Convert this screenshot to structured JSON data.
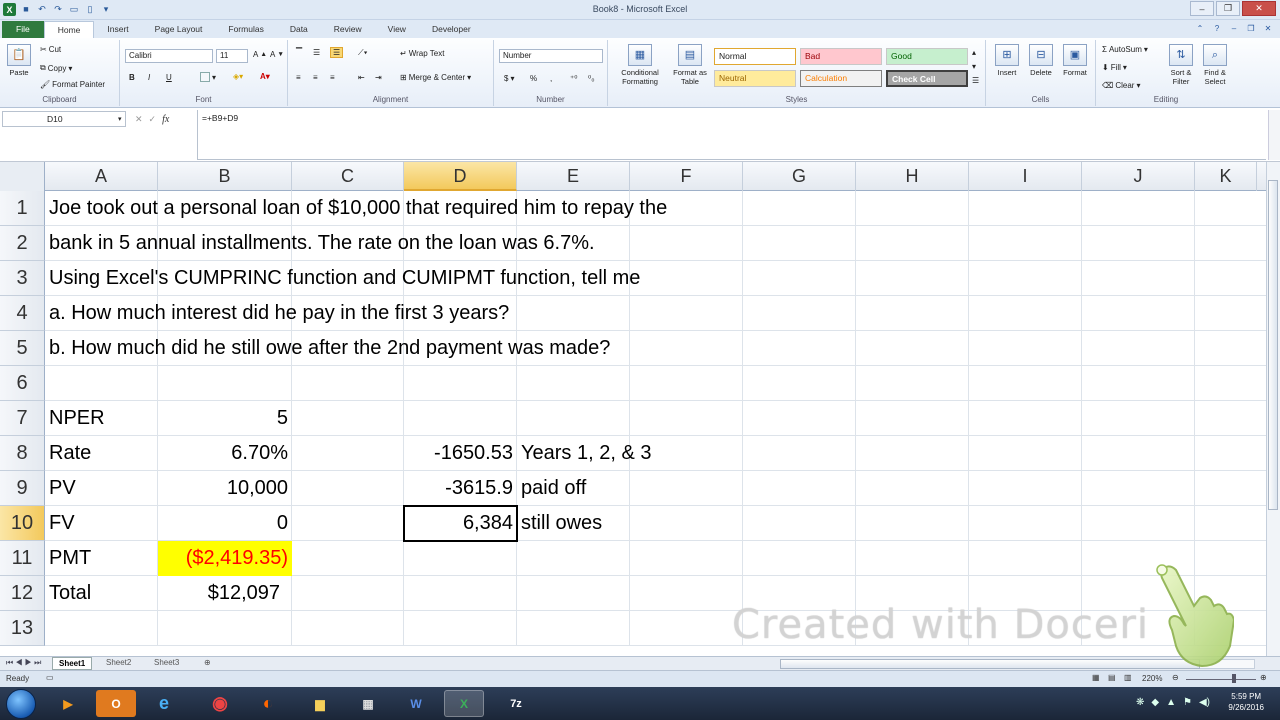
{
  "window": {
    "title": "Book8 - Microsoft Excel"
  },
  "ribbon_tabs": [
    "File",
    "Home",
    "Insert",
    "Page Layout",
    "Formulas",
    "Data",
    "Review",
    "View",
    "Developer"
  ],
  "ribbon": {
    "clipboard": {
      "paste": "Paste",
      "cut": "Cut",
      "copy": "Copy",
      "format_painter": "Format Painter",
      "name": "Clipboard"
    },
    "font": {
      "family": "Calibri",
      "size": "11",
      "name": "Font",
      "bold": "B",
      "italic": "I",
      "underline": "U"
    },
    "alignment": {
      "wrap": "Wrap Text",
      "merge": "Merge & Center",
      "name": "Alignment"
    },
    "number": {
      "format": "Number",
      "currency": "$",
      "percent": "%",
      "comma": ",",
      "name": "Number"
    },
    "styles": {
      "conditional": "Conditional Formatting",
      "format_table": "Format as Table",
      "normal": "Normal",
      "bad": "Bad",
      "good": "Good",
      "neutral": "Neutral",
      "calculation": "Calculation",
      "check_cell": "Check Cell",
      "name": "Styles"
    },
    "cells": {
      "insert": "Insert",
      "delete": "Delete",
      "format": "Format",
      "name": "Cells"
    },
    "editing": {
      "autosum": "AutoSum",
      "fill": "Fill",
      "clear": "Clear",
      "sort": "Sort & Filter",
      "find": "Find & Select",
      "name": "Editing"
    }
  },
  "formula_bar": {
    "name_box": "D10",
    "formula": "=+B9+D9",
    "fx": "fx"
  },
  "columns": [
    "A",
    "B",
    "C",
    "D",
    "E",
    "F",
    "G",
    "H",
    "I",
    "J",
    "K"
  ],
  "rows": [
    {
      "n": "1",
      "a": "Joe took out a personal loan of $10,000 that required him to repay the"
    },
    {
      "n": "2",
      "a": "bank in 5 annual installments. The rate on the loan was 6.7%."
    },
    {
      "n": "3",
      "a": "Using Excel's CUMPRINC function and CUMIPMT function, tell me"
    },
    {
      "n": "4",
      "a": "   a. How much interest did he pay in the first 3 years?"
    },
    {
      "n": "5",
      "a": "   b. How much did he still owe after the 2nd payment was made?"
    },
    {
      "n": "6",
      "a": ""
    },
    {
      "n": "7",
      "a": "NPER",
      "b": "5"
    },
    {
      "n": "8",
      "a": "Rate",
      "b": "6.70%",
      "d": "-1650.53",
      "e": "Years 1, 2, & 3"
    },
    {
      "n": "9",
      "a": "PV",
      "b": "10,000",
      "d": "-3615.9",
      "e": "paid off"
    },
    {
      "n": "10",
      "a": "FV",
      "b": "0",
      "d": "6,384",
      "e": "still owes"
    },
    {
      "n": "11",
      "a": "PMT",
      "b": "($2,419.35)"
    },
    {
      "n": "12",
      "a": "Total",
      "b": "$12,097"
    },
    {
      "n": "13",
      "a": ""
    }
  ],
  "sheets": [
    "Sheet1",
    "Sheet2",
    "Sheet3"
  ],
  "status": {
    "ready": "Ready",
    "zoom": "220%"
  },
  "taskbar": {
    "time": "5:59 PM",
    "date": "9/26/2016"
  },
  "watermark": "Created with Doceri",
  "colors": {
    "pmt_fill": "#ffff00",
    "pmt_text": "#ff0000",
    "selected_header": "#f3c95c",
    "file_tab": "#2f7a3e"
  }
}
